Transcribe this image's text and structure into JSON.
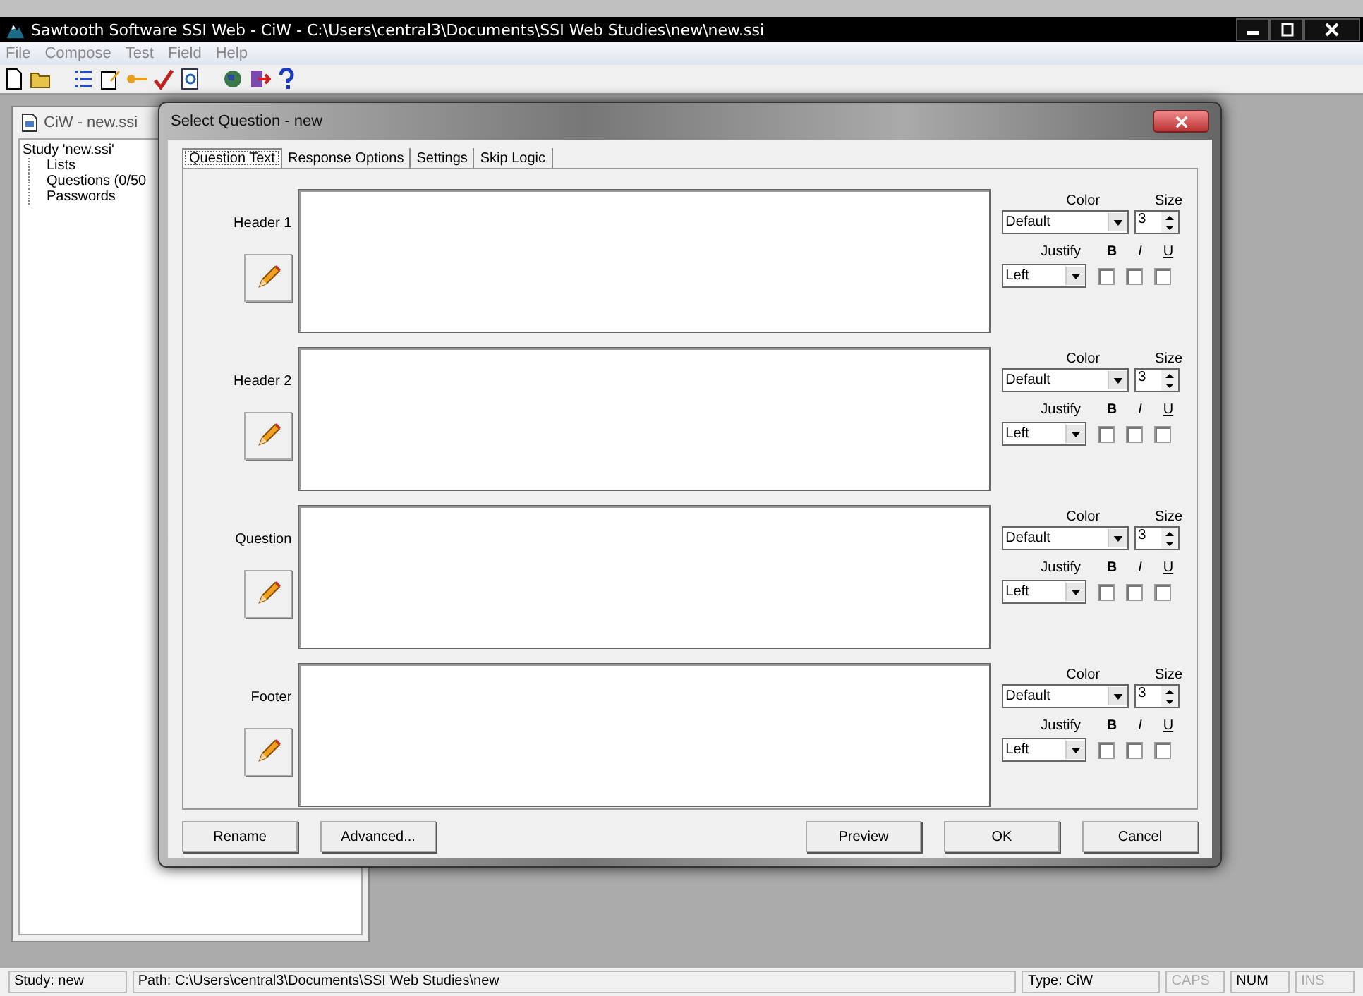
{
  "window": {
    "title": "Sawtooth Software SSI Web - CiW - C:\\Users\\central3\\Documents\\SSI Web Studies\\new\\new.ssi"
  },
  "menu": [
    "File",
    "Compose",
    "Test",
    "Field",
    "Help"
  ],
  "side_panel": {
    "title": "CiW - new.ssi",
    "tree": {
      "label": "Study 'new.ssi'",
      "children": [
        {
          "label": "Lists"
        },
        {
          "label": "Questions (0/50"
        },
        {
          "label": "Passwords"
        }
      ]
    }
  },
  "dialog": {
    "title": "Select Question - new",
    "tabs": [
      {
        "label": "Question Text",
        "selected": true
      },
      {
        "label": "Response Options",
        "selected": false
      },
      {
        "label": "Settings",
        "selected": false
      },
      {
        "label": "Skip Logic",
        "selected": false
      }
    ],
    "sections": [
      {
        "label": "Header 1",
        "color_label": "Color",
        "color_choice": "Default",
        "size_label": "Size",
        "size": "3",
        "justify_label": "Justify",
        "justify": "Left",
        "b_label": "B",
        "i_label": "I",
        "u_label": "U",
        "bold": false,
        "italic": false,
        "underline": false
      },
      {
        "label": "Header 2",
        "color_label": "Color",
        "color_choice": "Default",
        "size_label": "Size",
        "size": "3",
        "justify_label": "Justify",
        "justify": "Left",
        "b_label": "B",
        "i_label": "I",
        "u_label": "U",
        "bold": false,
        "italic": false,
        "underline": false
      },
      {
        "label": "Question",
        "color_label": "Color",
        "color_choice": "Default",
        "size_label": "Size",
        "size": "3",
        "justify_label": "Justify",
        "justify": "Left",
        "b_label": "B",
        "i_label": "I",
        "u_label": "U",
        "bold": false,
        "italic": false,
        "underline": false
      },
      {
        "label": "Footer",
        "color_label": "Color",
        "color_choice": "Default",
        "size_label": "Size",
        "size": "3",
        "justify_label": "Justify",
        "justify": "Left",
        "b_label": "B",
        "i_label": "I",
        "u_label": "U",
        "bold": false,
        "italic": false,
        "underline": false
      }
    ],
    "left_buttons": [
      "Rename",
      "Advanced..."
    ],
    "right_buttons": [
      "Preview",
      "OK",
      "Cancel"
    ]
  },
  "status_bar": {
    "study": "Study: new",
    "path": "Path: C:\\Users\\central3\\Documents\\SSI Web Studies\\new",
    "type": "Type: CiW",
    "indicators": [
      {
        "label": "CAPS",
        "on": false
      },
      {
        "label": "NUM",
        "on": true
      },
      {
        "label": "INS",
        "on": false
      }
    ]
  }
}
